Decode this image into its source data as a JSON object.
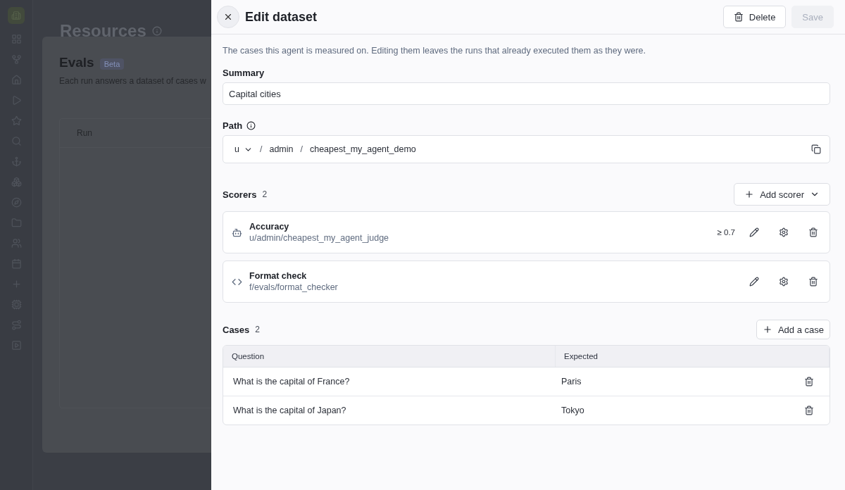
{
  "background": {
    "page_title": "Resources",
    "modal": {
      "title": "Evals",
      "badge": "Beta",
      "description": "Each run answers a dataset of cases w",
      "columns": [
        "Run"
      ]
    }
  },
  "drawer": {
    "title": "Edit dataset",
    "delete_button": "Delete",
    "save_button": {
      "label": "Save",
      "disabled": true
    },
    "description": "The cases this agent is measured on. Editing them leaves the runs that already executed them as they were.",
    "summary": {
      "label": "Summary",
      "value": "Capital cities"
    },
    "path": {
      "label": "Path",
      "prefix": "u",
      "segments": [
        "admin",
        "cheapest_my_agent_demo"
      ],
      "separator": "/"
    },
    "scorers": {
      "label": "Scorers",
      "count": "2",
      "add_button": "Add scorer",
      "items": [
        {
          "kind": "judge",
          "name": "Accuracy",
          "path": "u/admin/cheapest_my_agent_judge",
          "threshold": "≥ 0.7"
        },
        {
          "kind": "code",
          "name": "Format check",
          "path": "f/evals/format_checker"
        }
      ]
    },
    "cases": {
      "label": "Cases",
      "count": "2",
      "add_button": "Add a case",
      "columns": [
        "Question",
        "Expected"
      ],
      "rows": [
        {
          "question": "What is the capital of France?",
          "expected": "Paris"
        },
        {
          "question": "What is the capital of Japan?",
          "expected": "Tokyo"
        }
      ]
    }
  }
}
